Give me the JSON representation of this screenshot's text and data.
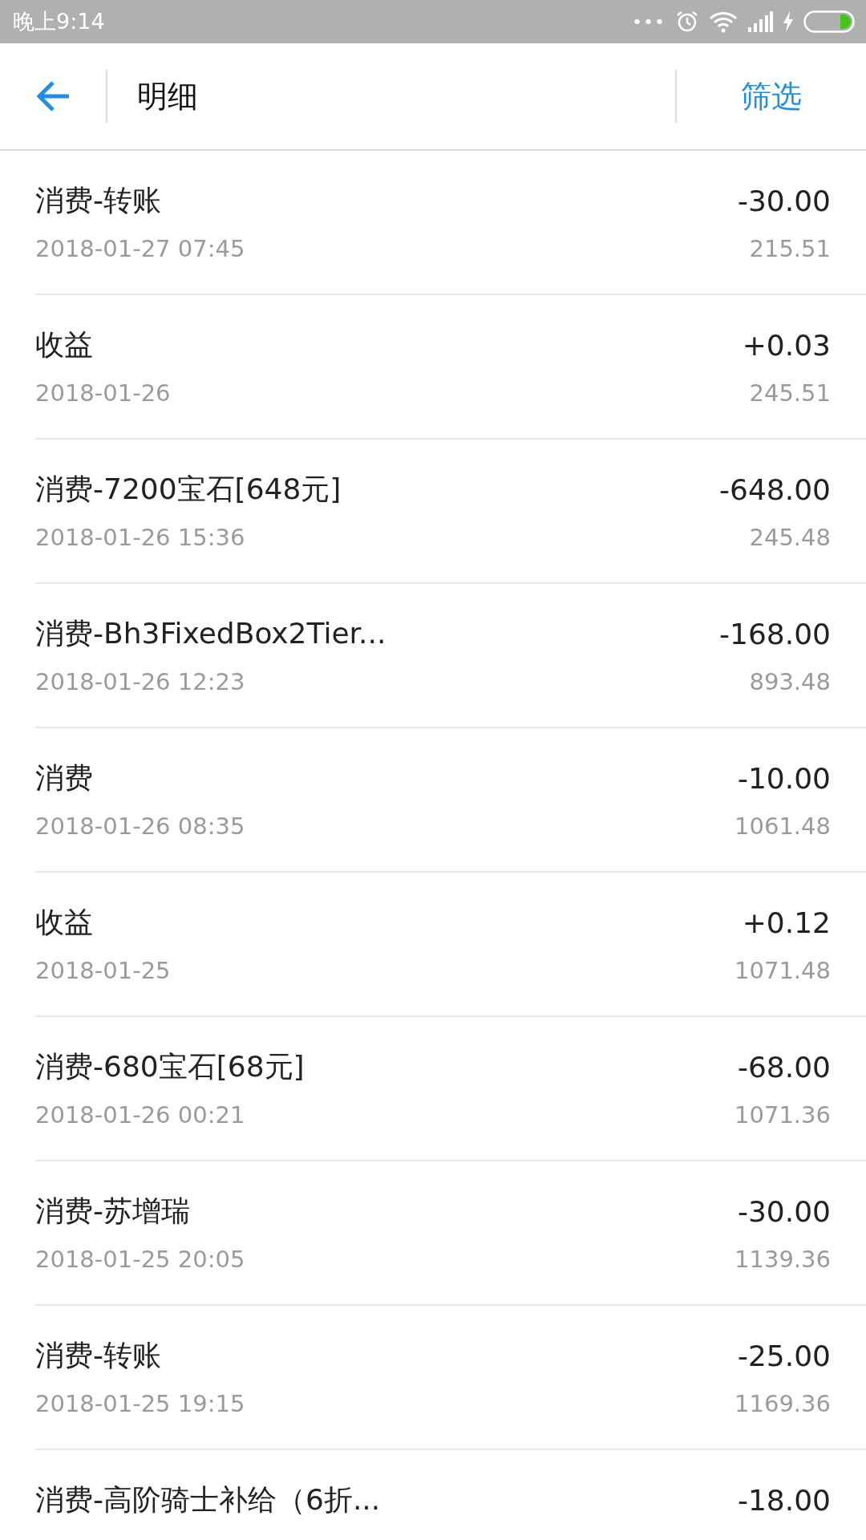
{
  "status_bar": {
    "time": "晚上9:14",
    "more": "•••"
  },
  "header": {
    "title": "明细",
    "action": "筛选"
  },
  "transactions": [
    {
      "title": "消费-转账",
      "amount": "-30.00",
      "date": "2018-01-27 07:45",
      "balance": "215.51"
    },
    {
      "title": "收益",
      "amount": "+0.03",
      "date": "2018-01-26",
      "balance": "245.51"
    },
    {
      "title": "消费-7200宝石[648元]",
      "amount": "-648.00",
      "date": "2018-01-26 15:36",
      "balance": "245.48"
    },
    {
      "title": "消费-Bh3FixedBox2Tier...",
      "amount": "-168.00",
      "date": "2018-01-26 12:23",
      "balance": "893.48"
    },
    {
      "title": "消费",
      "amount": "-10.00",
      "date": "2018-01-26 08:35",
      "balance": "1061.48"
    },
    {
      "title": "收益",
      "amount": "+0.12",
      "date": "2018-01-25",
      "balance": "1071.48"
    },
    {
      "title": "消费-680宝石[68元]",
      "amount": "-68.00",
      "date": "2018-01-26 00:21",
      "balance": "1071.36"
    },
    {
      "title": "消费-苏增瑞",
      "amount": "-30.00",
      "date": "2018-01-25 20:05",
      "balance": "1139.36"
    },
    {
      "title": "消费-转账",
      "amount": "-25.00",
      "date": "2018-01-25 19:15",
      "balance": "1169.36"
    },
    {
      "title": "消费-高阶骑士补给（6折...",
      "amount": "-18.00"
    }
  ]
}
